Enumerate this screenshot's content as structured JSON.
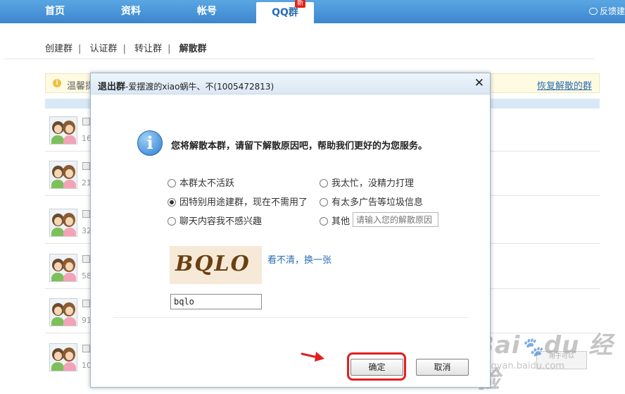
{
  "topnav": {
    "tabs": [
      {
        "label": "首页"
      },
      {
        "label": "资料"
      },
      {
        "label": "帐号"
      },
      {
        "label": "QQ群"
      }
    ],
    "new_badge": "新",
    "feedback": "反馈建"
  },
  "subnav": {
    "items": [
      "创建群",
      "认证群",
      "转让群",
      "解散群"
    ],
    "separator": "|"
  },
  "notice": {
    "text": "温馨提",
    "restore_link": "恢复解散的群"
  },
  "list": {
    "rows": [
      {
        "num": "16"
      },
      {
        "num": "21"
      },
      {
        "num": "32"
      },
      {
        "num": "58"
      },
      {
        "num": "91"
      },
      {
        "num": "10"
      }
    ]
  },
  "dialog": {
    "title_bold": "退出群",
    "title_rest": "-爱摆渡的xiao蜗牛、不(1005472813)",
    "message": "您将解散本群，请留下解散原因吧，帮助我们更好的为您服务。",
    "options": [
      {
        "label": "本群太不活跃",
        "selected": false
      },
      {
        "label": "我太忙，没精力打理",
        "selected": false
      },
      {
        "label": "因特别用途建群，现在不需用了",
        "selected": true
      },
      {
        "label": "有太多广告等垃圾信息",
        "selected": false
      },
      {
        "label": "聊天内容我不感兴趣",
        "selected": false
      },
      {
        "label": "其他",
        "selected": false
      }
    ],
    "other_placeholder": "请输入您的解散原因",
    "captcha_text": "BQLO",
    "captcha_refresh": "看不清，换一张",
    "captcha_value": "bqlo",
    "confirm": "确定",
    "cancel": "取消"
  },
  "background_button": "用于可以",
  "colors": {
    "nav_blue": "#3b86cf",
    "link_blue": "#2a6db3",
    "highlight_red": "#e02020"
  }
}
